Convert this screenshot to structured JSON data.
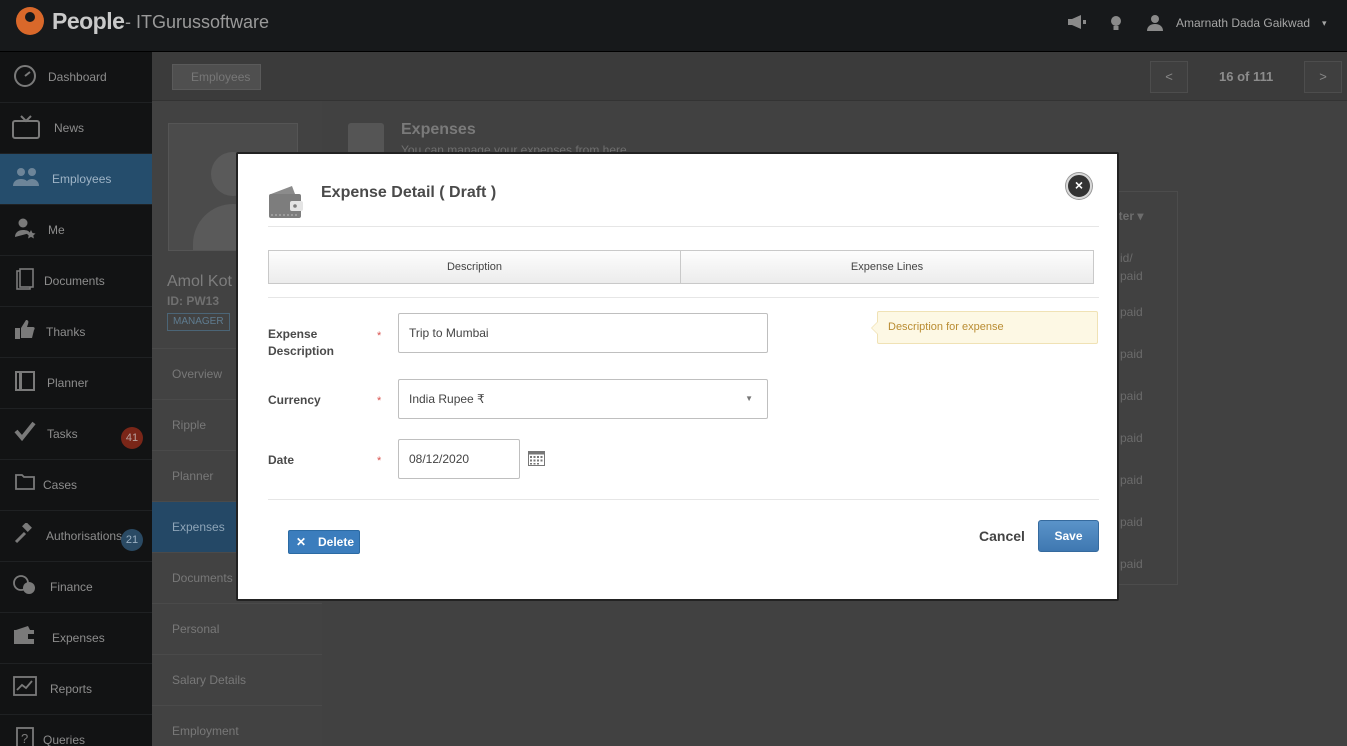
{
  "topbar": {
    "app_name": "People",
    "company": "- ITGurussoftware",
    "user_name": "Amarnath Dada Gaikwad",
    "caret": "▾"
  },
  "sidebar": {
    "items": [
      {
        "label": "Dashboard",
        "icon": "dashboard-icon"
      },
      {
        "label": "News",
        "icon": "tv-icon"
      },
      {
        "label": "Employees",
        "icon": "people-icon"
      },
      {
        "label": "Me",
        "icon": "user-star-icon"
      },
      {
        "label": "Documents",
        "icon": "document-icon"
      },
      {
        "label": "Thanks",
        "icon": "thumbs-up-icon"
      },
      {
        "label": "Planner",
        "icon": "book-icon"
      },
      {
        "label": "Tasks",
        "icon": "check-icon",
        "badge": "41"
      },
      {
        "label": "Cases",
        "icon": "folder-icon"
      },
      {
        "label": "Authorisations",
        "icon": "gavel-icon",
        "badge": "21"
      },
      {
        "label": "Finance",
        "icon": "coins-icon"
      },
      {
        "label": "Expenses",
        "icon": "wallet-icon"
      },
      {
        "label": "Reports",
        "icon": "chart-icon"
      },
      {
        "label": "Queries",
        "icon": "question-icon"
      }
    ]
  },
  "background": {
    "breadcrumb": "Employees",
    "pager_prev": "<",
    "pager_text": "16 of 111",
    "pager_next": ">",
    "employee_name": "Amol Kot",
    "employee_id": "ID: PW13",
    "role": "MANAGER",
    "subnav": [
      "Overview",
      "Ripple",
      "Planner",
      "Expenses",
      "Documents",
      "Personal",
      "Salary Details",
      "Employment"
    ],
    "section_title": "Expenses",
    "section_subtitle": "You can manage your expenses from here",
    "filter": "ilter ▾",
    "paid_header": "id/\npaid",
    "paid_cells": [
      "paid",
      "paid",
      "paid",
      "paid",
      "paid",
      "paid",
      "paid"
    ]
  },
  "modal": {
    "title": "Expense Detail ( Draft )",
    "close": "×",
    "tabs": [
      "Description",
      "Expense Lines"
    ],
    "fields": {
      "description_label": "Expense Description",
      "description_value": "Trip to Mumbai",
      "currency_label": "Currency",
      "currency_value": "India Rupee ₹",
      "date_label": "Date",
      "date_value": "08/12/2020",
      "required_mark": "*"
    },
    "hint": "Description for expense",
    "delete_label": "Delete",
    "delete_icon": "✕",
    "cancel_label": "Cancel",
    "save_label": "Save"
  },
  "colors": {
    "accent": "#3b7dbd",
    "sidebar_active": "#254d6c",
    "badge_red": "#7a2618"
  }
}
